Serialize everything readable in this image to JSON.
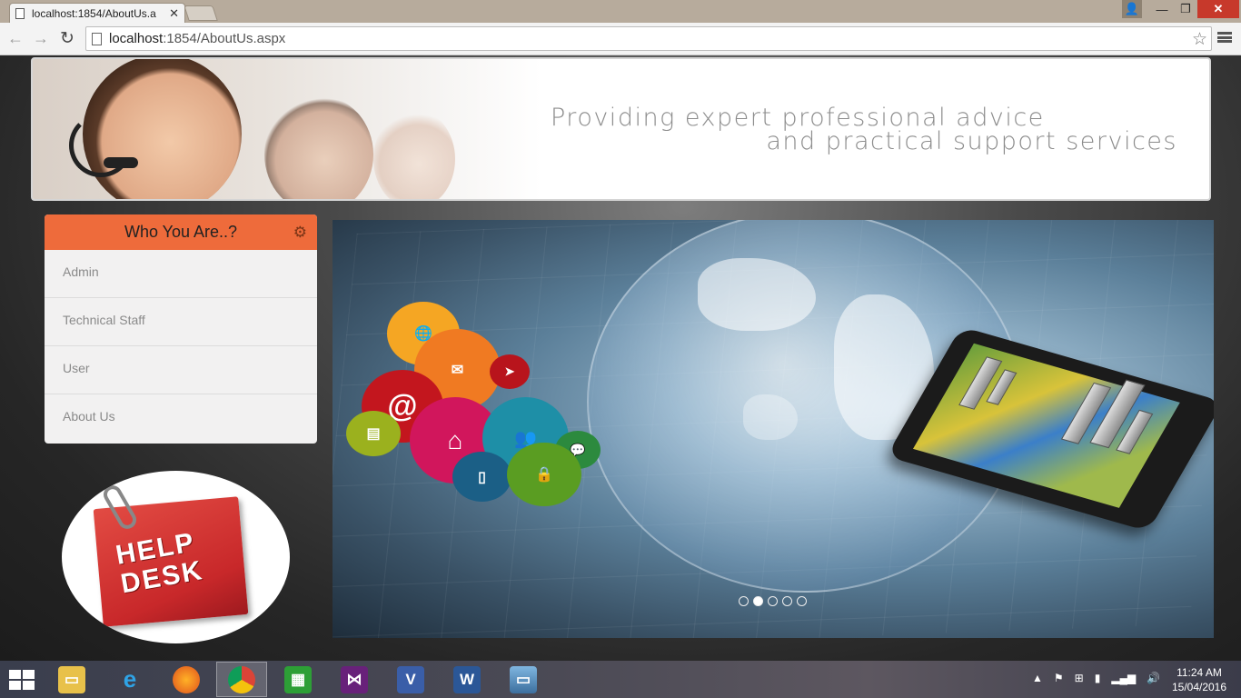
{
  "browser": {
    "tab_title": "localhost:1854/AboutUs.a",
    "url_host": "localhost",
    "url_path": ":1854/AboutUs.aspx"
  },
  "banner": {
    "tagline_line1": "Providing expert professional advice",
    "tagline_line2": "and practical support services"
  },
  "sidebar": {
    "title": "Who You Are..?",
    "items": [
      {
        "label": "Admin"
      },
      {
        "label": "Technical Staff"
      },
      {
        "label": "User"
      },
      {
        "label": "About Us"
      }
    ]
  },
  "helpdesk": {
    "logo_text_1": "HELP",
    "logo_text_2": "DESK"
  },
  "slider": {
    "total_slides": 5,
    "active_slide": 2
  },
  "taskbar": {
    "time": "11:24 AM",
    "date": "15/04/2016",
    "apps": [
      "file-explorer",
      "internet-explorer",
      "firefox",
      "chrome",
      "store",
      "visual-studio",
      "visio",
      "word",
      "photos"
    ]
  },
  "colors": {
    "accent": "#ee6b3b",
    "tagline": "#8c8c8c"
  }
}
